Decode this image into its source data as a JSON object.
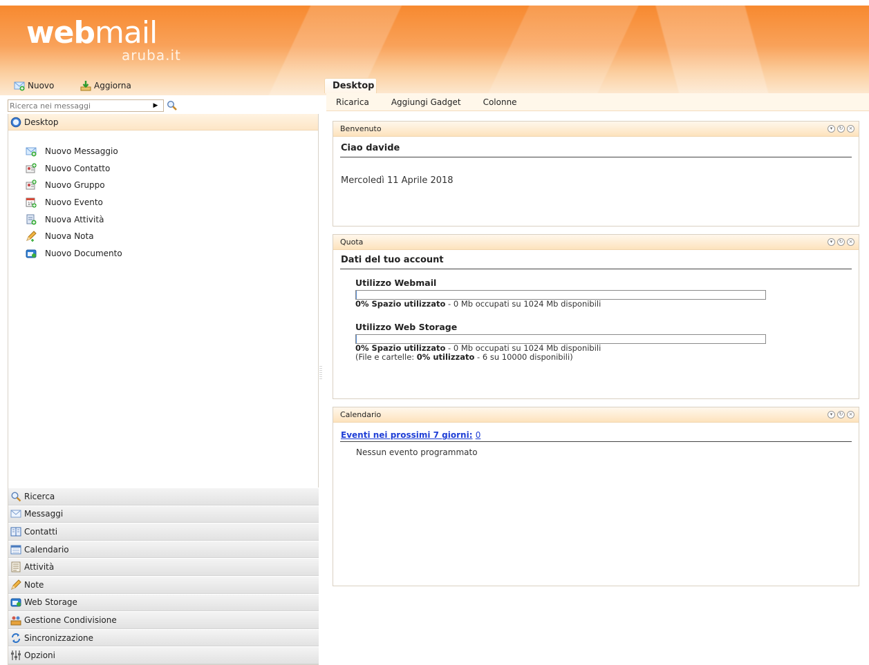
{
  "brand": {
    "word_bold": "web",
    "word_light": "mail",
    "sub": "aruba.it"
  },
  "toolbar": {
    "new_label": "Nuovo",
    "refresh_label": "Aggiorna"
  },
  "search": {
    "placeholder": "Ricerca nei messaggi"
  },
  "left": {
    "desktop_label": "Desktop",
    "quick_items": [
      {
        "label": "Nuovo Messaggio",
        "icon": "new-message-icon"
      },
      {
        "label": "Nuovo Contatto",
        "icon": "new-contact-icon"
      },
      {
        "label": "Nuovo Gruppo",
        "icon": "new-group-icon"
      },
      {
        "label": "Nuovo Evento",
        "icon": "new-event-icon"
      },
      {
        "label": "Nuova Attività",
        "icon": "new-task-icon"
      },
      {
        "label": "Nuova Nota",
        "icon": "new-note-icon"
      },
      {
        "label": "Nuovo Documento",
        "icon": "new-document-icon"
      }
    ],
    "sections": [
      {
        "label": "Ricerca",
        "icon": "search-icon"
      },
      {
        "label": "Messaggi",
        "icon": "envelope-icon"
      },
      {
        "label": "Contatti",
        "icon": "address-book-icon"
      },
      {
        "label": "Calendario",
        "icon": "calendar-icon"
      },
      {
        "label": "Attività",
        "icon": "task-list-icon"
      },
      {
        "label": "Note",
        "icon": "note-icon"
      },
      {
        "label": "Web Storage",
        "icon": "web-storage-icon"
      },
      {
        "label": "Gestione Condivisione",
        "icon": "sharing-icon"
      },
      {
        "label": "Sincronizzazione",
        "icon": "sync-icon"
      },
      {
        "label": "Opzioni",
        "icon": "options-icon"
      }
    ]
  },
  "main": {
    "tab_label": "Desktop",
    "subtoolbar": {
      "reload": "Ricarica",
      "add_gadget": "Aggiungi Gadget",
      "columns": "Colonne"
    },
    "welcome": {
      "header": "Benvenuto",
      "greeting": "Ciao davide",
      "date": "Mercoledì 11 Aprile 2018"
    },
    "quota": {
      "header": "Quota",
      "title": "Dati del tuo account",
      "webmail": {
        "title": "Utilizzo Webmail",
        "percent": 0,
        "used_label": "0% Spazio utilizzato",
        "detail": " - 0 Mb occupati su 1024 Mb disponibili"
      },
      "storage": {
        "title": "Utilizzo Web Storage",
        "percent": 0,
        "used_label": "0% Spazio utilizzato",
        "detail": " - 0 Mb occupati su 1024 Mb disponibili",
        "files_prefix": "(File e cartelle: ",
        "files_used": "0% utilizzato",
        "files_detail": " - 6 su 10000 disponibili)"
      }
    },
    "calendar": {
      "header": "Calendario",
      "events_link": "Eventi nei prossimi 7 giorni:",
      "events_count": "0",
      "no_events": "Nessun evento programmato"
    }
  },
  "colors": {
    "accent_orange": "#f7892f",
    "link_blue": "#1f3fd6",
    "panel_border": "#d9d0c2"
  }
}
